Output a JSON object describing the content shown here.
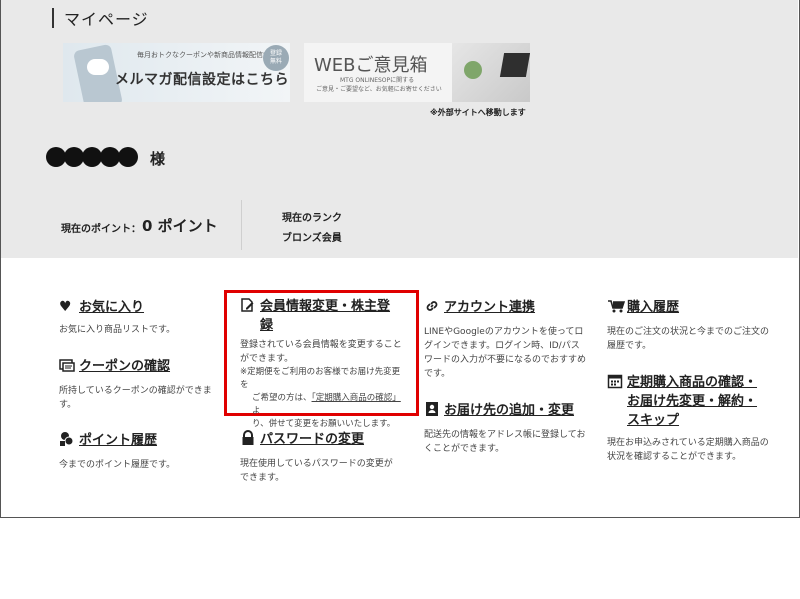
{
  "header": {
    "title": "マイページ"
  },
  "banners": {
    "mailmag": {
      "sub": "毎月おトクなクーポンや新商品情報配信中！",
      "main": "メルマガ配信設定はこちら",
      "badge_line1": "登録",
      "badge_line2": "無料"
    },
    "webopinion": {
      "title": "WEBご意見箱",
      "sub1": "MTG ONLINESOPに関する",
      "sub2": "ご意見・ご要望など、お気軽にお寄せください"
    },
    "external_note": "※外部サイトへ移動します"
  },
  "user": {
    "suffix": "様"
  },
  "status": {
    "points_label": "現在のポイント：",
    "points_value": "0 ポイント",
    "rank_label": "現在のランク",
    "rank_value": "ブロンズ会員"
  },
  "menu": {
    "favorites": {
      "icon": "heart-icon",
      "title": "お気に入り",
      "desc": "お気に入り商品リストです。"
    },
    "coupon": {
      "icon": "coupon-icon",
      "title": "クーポンの確認",
      "desc": "所持しているクーポンの確認ができます。"
    },
    "points": {
      "icon": "coins-icon",
      "title": "ポイント履歴",
      "desc": "今までのポイント履歴です。"
    },
    "member_info": {
      "icon": "edit-icon",
      "title1": "会員情報変更・株主登",
      "title2": "録",
      "desc": "登録されている会員情報を変更することができます。",
      "note1": "※定期便をご利用のお客様でお届け先変更を",
      "note2a": "ご希望の方は、",
      "note2_link": "「定期購入商品の確認」",
      "note2b": "よ",
      "note3": "り、併せて変更をお願いいたします。"
    },
    "password": {
      "icon": "lock-icon",
      "title": "パスワードの変更",
      "desc": "現在使用しているパスワードの変更ができます。"
    },
    "account_link": {
      "icon": "link-icon",
      "title": "アカウント連携",
      "desc": "LINEやGoogleのアカウントを使ってログインできます。ログイン時、ID/パスワードの入力が不要になるのでおすすめです。"
    },
    "address": {
      "icon": "address-book-icon",
      "title": "お届け先の追加・変更",
      "desc": "配送先の情報をアドレス帳に登録しておくことができます。"
    },
    "purchase_history": {
      "icon": "cart-icon",
      "title": "購入履歴",
      "desc": "現在のご注文の状況と今までのご注文の履歴です。"
    },
    "subscription": {
      "icon": "calendar-icon",
      "title1": "定期購入商品の確認・",
      "title2": "お届け先変更・解約・",
      "title3": "スキップ",
      "desc": "現在お申込みされている定期購入商品の状況を確認することができます。"
    }
  }
}
